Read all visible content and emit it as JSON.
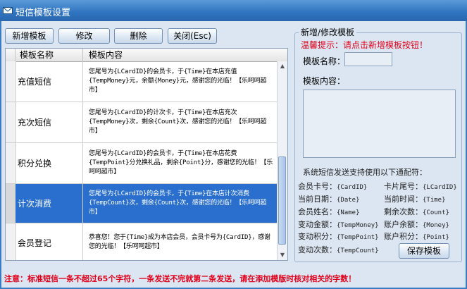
{
  "window": {
    "title": "短信模板设置"
  },
  "toolbar": {
    "add_label": "新增模板",
    "edit_label": "修改",
    "delete_label": "删除",
    "close_label": "关闭(Esc)"
  },
  "table": {
    "headers": [
      "模板名称",
      "模板内容"
    ],
    "rows": [
      {
        "name": "充值短信",
        "content": "您尾号为{LCardID}的会员卡，于{Time}在本店充值{TempMoney}元，余额{Money}元，感谢您的光临！【乐呵呵超市】"
      },
      {
        "name": "充次短信",
        "content": "您尾号为{LCardID}的计次卡，于{Time}在本店充次{TempMoney}次，剩余{Count}次，感谢您的光临！【乐呵呵超市】"
      },
      {
        "name": "积分兑换",
        "content": "您尾号为{LCardID}的会员卡，于{Time}在本店花费{TempPoint}分兑换礼品，剩余{Point}分，感谢您的光临！【乐呵呵超市】"
      },
      {
        "name": "计次消费",
        "content": "您尾号为{LCardID}的会员卡，于{Time}在本店计次消费{TempCount}次，剩余{Count}次，感谢您的光临！【乐呵呵超市】"
      },
      {
        "name": "会员登记",
        "content": "恭喜您！您于{Time}成为本店会员，会员卡号为{CardID}，感谢您的光临！【乐呵呵超市】"
      }
    ]
  },
  "editor": {
    "group_title": "新增/修改模板",
    "tip": "温馨提示：请点击新增模板按钮！",
    "name_label": "模板名称：",
    "name_value": "",
    "content_label": "模板内容：",
    "content_value": "",
    "variables_heading": "系统短信发送支持使用以下通配符：",
    "variables": [
      {
        "label": "会员卡号：",
        "code": "{CardID}"
      },
      {
        "label": "卡片尾号：",
        "code": "{LCardID}"
      },
      {
        "label": "当前日期：",
        "code": "{Date}"
      },
      {
        "label": "当前时间：",
        "code": "{Time}"
      },
      {
        "label": "会员姓名：",
        "code": "{Name}"
      },
      {
        "label": "剩余次数：",
        "code": "{Count}"
      },
      {
        "label": "变动金额：",
        "code": "{TempMoney}"
      },
      {
        "label": "账户余额：",
        "code": "{Money}"
      },
      {
        "label": "变动积分：",
        "code": "{TempPoint}"
      },
      {
        "label": "账户积分：",
        "code": "{Point}"
      },
      {
        "label": "变动次数：",
        "code": "{TempCount}"
      }
    ],
    "save_label": "保存模板"
  },
  "footer": {
    "note": "注意：标准短信一条不超过65个字符，一条发送不完就第二条发送，请在添加模版时核对相关的字数！"
  },
  "colors": {
    "title_bar": "#2f73bf",
    "selection": "#2a6fcd",
    "warning": "#e2001a"
  }
}
